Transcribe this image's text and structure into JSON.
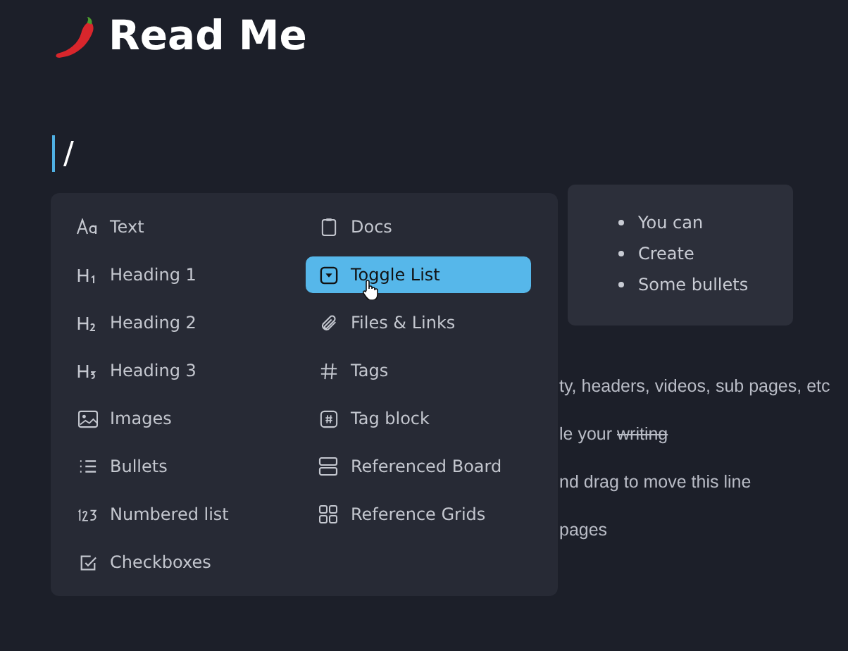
{
  "page": {
    "title": "Read Me",
    "command": "/"
  },
  "menu": {
    "columns": [
      [
        {
          "label": "Text",
          "kind": "text",
          "selected": false
        },
        {
          "label": "Heading 1",
          "kind": "h1",
          "selected": false
        },
        {
          "label": "Heading 2",
          "kind": "h2",
          "selected": false
        },
        {
          "label": "Heading 3",
          "kind": "h3",
          "selected": false
        },
        {
          "label": "Images",
          "kind": "image",
          "selected": false
        },
        {
          "label": "Bullets",
          "kind": "bullets",
          "selected": false
        },
        {
          "label": "Numbered list",
          "kind": "numbers",
          "selected": false
        },
        {
          "label": "Checkboxes",
          "kind": "checkbox",
          "selected": false
        }
      ],
      [
        {
          "label": "Docs",
          "kind": "doc",
          "selected": false
        },
        {
          "label": "Toggle List",
          "kind": "toggle",
          "selected": true
        },
        {
          "label": "Files & Links",
          "kind": "file",
          "selected": false
        },
        {
          "label": "Tags",
          "kind": "tags",
          "selected": false
        },
        {
          "label": "Tag block",
          "kind": "tagblock",
          "selected": false
        },
        {
          "label": "Referenced Board",
          "kind": "board",
          "selected": false
        },
        {
          "label": "Reference Grids",
          "kind": "grid",
          "selected": false
        }
      ]
    ]
  },
  "bullet_card": [
    "You can",
    "Create",
    "Some bullets"
  ],
  "lines": [
    {
      "text": "ty, headers, videos, sub pages, etc"
    },
    {
      "text": "le your ",
      "struck": "writing"
    },
    {
      "text": "nd drag to move this line"
    },
    {
      "text": "pages"
    }
  ]
}
